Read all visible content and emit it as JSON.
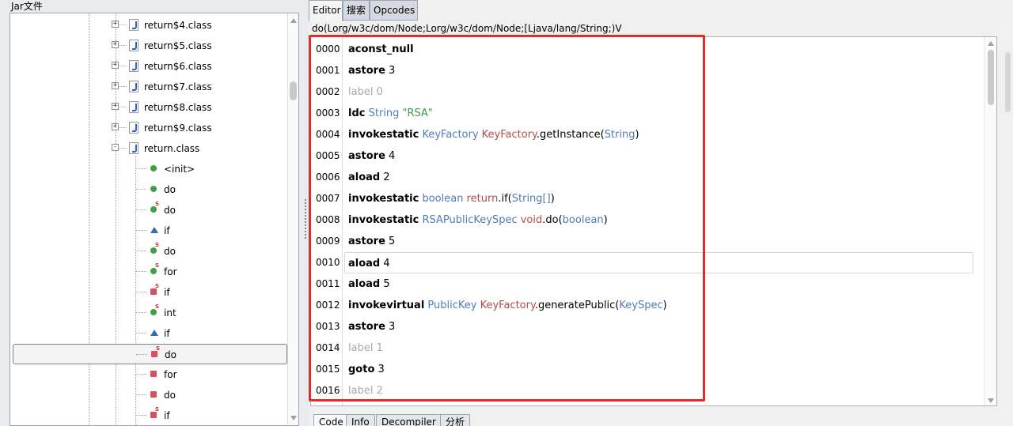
{
  "left_panel": {
    "title": "Jar文件",
    "tree_items": [
      {
        "label": "return$4.class",
        "kind": "class",
        "expanded": false
      },
      {
        "label": "return$5.class",
        "kind": "class",
        "expanded": false
      },
      {
        "label": "return$6.class",
        "kind": "class",
        "expanded": false
      },
      {
        "label": "return$7.class",
        "kind": "class",
        "expanded": false
      },
      {
        "label": "return$8.class",
        "kind": "class",
        "expanded": false
      },
      {
        "label": "return$9.class",
        "kind": "class",
        "expanded": false
      },
      {
        "label": "return.class",
        "kind": "class",
        "expanded": true
      },
      {
        "label": "<init>",
        "kind": "public-method"
      },
      {
        "label": "do",
        "kind": "public-method"
      },
      {
        "label": "do",
        "kind": "static-method"
      },
      {
        "label": "if",
        "kind": "protected-method"
      },
      {
        "label": "do",
        "kind": "static-method"
      },
      {
        "label": "for",
        "kind": "static-method"
      },
      {
        "label": "if",
        "kind": "private-static-method"
      },
      {
        "label": "int",
        "kind": "static-method"
      },
      {
        "label": "if",
        "kind": "protected-method"
      },
      {
        "label": "do",
        "kind": "private-static-method",
        "selected": true
      },
      {
        "label": "for",
        "kind": "private-method"
      },
      {
        "label": "do",
        "kind": "private-method"
      },
      {
        "label": "if",
        "kind": "private-static-method"
      }
    ]
  },
  "right_panel": {
    "tabs": [
      {
        "label": "Editor",
        "active": true
      },
      {
        "label": "搜索",
        "active": false
      },
      {
        "label": "Opcodes",
        "active": false
      }
    ],
    "signature": "do(Lorg/w3c/dom/Node;Lorg/w3c/dom/Node;[Ljava/lang/String;)V",
    "highlight_color": "#e32b2b",
    "lines": [
      {
        "num": "0000",
        "parts": [
          {
            "t": "aconst_null",
            "c": "kw"
          }
        ]
      },
      {
        "num": "0001",
        "parts": [
          {
            "t": "astore",
            "c": "kw"
          },
          {
            "t": " 3",
            "c": "num"
          }
        ]
      },
      {
        "num": "0002",
        "parts": [
          {
            "t": "label 0",
            "c": "lbl"
          }
        ]
      },
      {
        "num": "0003",
        "parts": [
          {
            "t": "ldc",
            "c": "kw"
          },
          {
            "t": " String",
            "c": "type"
          },
          {
            "t": " \"RSA\"",
            "c": "str"
          }
        ]
      },
      {
        "num": "0004",
        "parts": [
          {
            "t": "invokestatic",
            "c": "kw"
          },
          {
            "t": " KeyFactory",
            "c": "type"
          },
          {
            "t": " KeyFactory",
            "c": "owner"
          },
          {
            "t": ".getInstance(",
            "c": "plain"
          },
          {
            "t": "String",
            "c": "type"
          },
          {
            "t": ")",
            "c": "plain"
          }
        ]
      },
      {
        "num": "0005",
        "parts": [
          {
            "t": "astore",
            "c": "kw"
          },
          {
            "t": " 4",
            "c": "num"
          }
        ]
      },
      {
        "num": "0006",
        "parts": [
          {
            "t": "aload",
            "c": "kw"
          },
          {
            "t": " 2",
            "c": "num"
          }
        ]
      },
      {
        "num": "0007",
        "parts": [
          {
            "t": "invokestatic",
            "c": "kw"
          },
          {
            "t": " boolean",
            "c": "type"
          },
          {
            "t": " return",
            "c": "owner"
          },
          {
            "t": ".if(",
            "c": "plain"
          },
          {
            "t": "String[]",
            "c": "type"
          },
          {
            "t": ")",
            "c": "plain"
          }
        ]
      },
      {
        "num": "0008",
        "parts": [
          {
            "t": "invokestatic",
            "c": "kw"
          },
          {
            "t": " RSAPublicKeySpec",
            "c": "type"
          },
          {
            "t": " void",
            "c": "owner"
          },
          {
            "t": ".do(",
            "c": "plain"
          },
          {
            "t": "boolean",
            "c": "type"
          },
          {
            "t": ")",
            "c": "plain"
          }
        ]
      },
      {
        "num": "0009",
        "parts": [
          {
            "t": "astore",
            "c": "kw"
          },
          {
            "t": " 5",
            "c": "num"
          }
        ]
      },
      {
        "num": "0010",
        "current": true,
        "parts": [
          {
            "t": "aload",
            "c": "kw"
          },
          {
            "t": " 4",
            "c": "num"
          }
        ]
      },
      {
        "num": "0011",
        "parts": [
          {
            "t": "aload",
            "c": "kw"
          },
          {
            "t": " 5",
            "c": "num"
          }
        ]
      },
      {
        "num": "0012",
        "parts": [
          {
            "t": "invokevirtual",
            "c": "kw"
          },
          {
            "t": " PublicKey",
            "c": "type"
          },
          {
            "t": " KeyFactory",
            "c": "owner"
          },
          {
            "t": ".generatePublic(",
            "c": "plain"
          },
          {
            "t": "KeySpec",
            "c": "type"
          },
          {
            "t": ")",
            "c": "plain"
          }
        ]
      },
      {
        "num": "0013",
        "parts": [
          {
            "t": "astore",
            "c": "kw"
          },
          {
            "t": " 3",
            "c": "num"
          }
        ]
      },
      {
        "num": "0014",
        "parts": [
          {
            "t": "label 1",
            "c": "lbl"
          }
        ]
      },
      {
        "num": "0015",
        "parts": [
          {
            "t": "goto",
            "c": "kw"
          },
          {
            "t": " 3",
            "c": "num"
          }
        ]
      },
      {
        "num": "0016",
        "parts": [
          {
            "t": "label 2",
            "c": "lbl"
          }
        ]
      }
    ],
    "bottom_tabs": [
      {
        "label": "Code",
        "active": true
      },
      {
        "label": "Info",
        "active": false
      },
      {
        "label": "Decompiler",
        "active": false
      },
      {
        "label": "分析",
        "active": false
      }
    ]
  },
  "icons": {
    "expander_collapsed": "+",
    "expander_expanded": "-"
  }
}
